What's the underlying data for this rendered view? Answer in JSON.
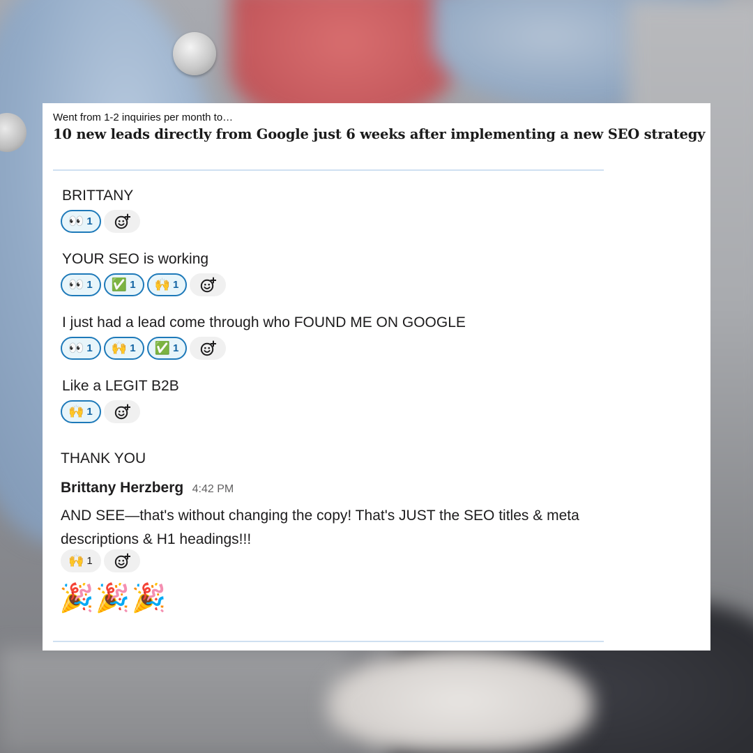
{
  "card": {
    "subtitle": "Went from 1-2 inquiries per month to…",
    "headline": "10 new leads directly from Google just 6 weeks after implementing a new SEO strategy"
  },
  "messages": [
    {
      "text": "BRITTANY",
      "reactions": [
        {
          "emoji": "👀",
          "count": "1",
          "name": "eyes"
        }
      ]
    },
    {
      "text": "YOUR SEO is working",
      "reactions": [
        {
          "emoji": "👀",
          "count": "1",
          "name": "eyes"
        },
        {
          "emoji": "✅",
          "count": "1",
          "name": "check"
        },
        {
          "emoji": "🙌",
          "count": "1",
          "name": "raised-hands"
        }
      ]
    },
    {
      "text": "I just had a lead come through who FOUND ME ON GOOGLE",
      "reactions": [
        {
          "emoji": "👀",
          "count": "1",
          "name": "eyes"
        },
        {
          "emoji": "🙌",
          "count": "1",
          "name": "raised-hands"
        },
        {
          "emoji": "✅",
          "count": "1",
          "name": "check"
        }
      ]
    },
    {
      "text": "Like a LEGIT B2B",
      "reactions": [
        {
          "emoji": "🙌",
          "count": "1",
          "name": "raised-hands"
        }
      ]
    },
    {
      "text": "THANK YOU"
    }
  ],
  "reply": {
    "author": "Brittany Herzberg",
    "time": "4:42 PM",
    "text": "AND SEE—that's without changing the copy! That's JUST the SEO titles & meta descriptions & H1 headings!!!",
    "reactions": [
      {
        "emoji": "🙌",
        "count": "1",
        "name": "raised-hands"
      }
    ],
    "trailing_emoji": [
      "🎉",
      "🎉",
      "🎉"
    ]
  },
  "add_reaction_icon": "add-emoji-icon",
  "colors": {
    "reaction_active_bg": "#e8f5fa",
    "reaction_active_border": "#1d79b9",
    "reaction_count": "#1264a3",
    "divider": "#cfe0f1"
  }
}
